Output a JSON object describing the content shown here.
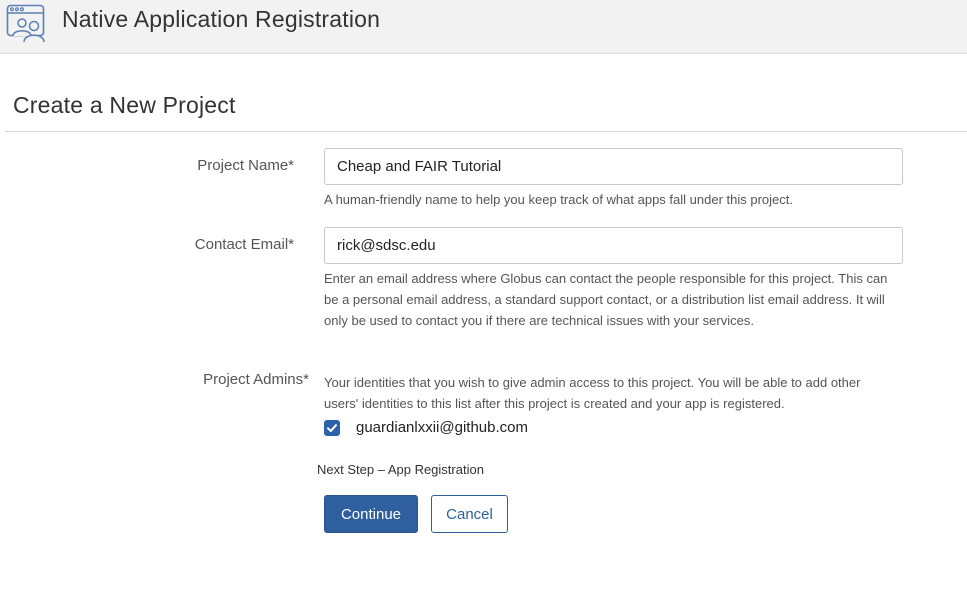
{
  "header": {
    "app_icon": "app-users-icon",
    "title": "Native Application Registration"
  },
  "page": {
    "heading": "Create a New Project"
  },
  "form": {
    "project_name": {
      "label": "Project Name*",
      "value": "Cheap and FAIR Tutorial",
      "help": "A human-friendly name to help you keep track of what apps fall under this project."
    },
    "contact_email": {
      "label": "Contact Email*",
      "value": "rick@sdsc.edu",
      "help": "Enter an email address where Globus can contact the people responsible for this project. This can be a personal email address, a standard support contact, or a distribution list email address. It will only be used to contact you if there are technical issues with your services."
    },
    "project_admins": {
      "label": "Project Admins*",
      "help": "Your identities that you wish to give admin access to this project. You will be able to add other users' identities to this list after this project is created and your app is registered.",
      "identities": [
        {
          "label": "guardianlxxii@github.com",
          "checked": true
        }
      ]
    },
    "next_step": "Next Step – App Registration",
    "continue_label": "Continue",
    "cancel_label": "Cancel"
  },
  "colors": {
    "primary": "#2f5f9e",
    "header_bg": "#f2f2f2",
    "checkbox": "#2e62a8"
  }
}
